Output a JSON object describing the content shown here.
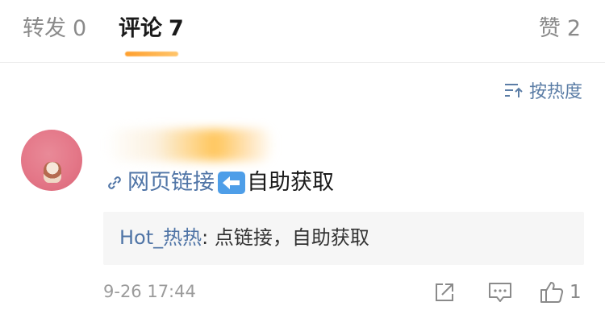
{
  "tabs": {
    "repost": {
      "label": "转发",
      "count": "0"
    },
    "comments": {
      "label": "评论",
      "count": "7"
    },
    "likes": {
      "label": "赞",
      "count": "2"
    }
  },
  "sort": {
    "label": "按热度",
    "icon": "sort-icon"
  },
  "comment": {
    "avatar_icon": "avatar",
    "link_text": "网页链接",
    "arrow_emoji": "left-arrow-emoji",
    "text_after": "自助获取",
    "reply": {
      "user": "Hot_热热",
      "text": ": 点链接，自助获取"
    },
    "time": "9-26 17:44",
    "like_count": "1"
  },
  "colors": {
    "accent": "#ff9f2d",
    "link": "#4f74a6",
    "emoji_blue": "#4e9ee8"
  }
}
